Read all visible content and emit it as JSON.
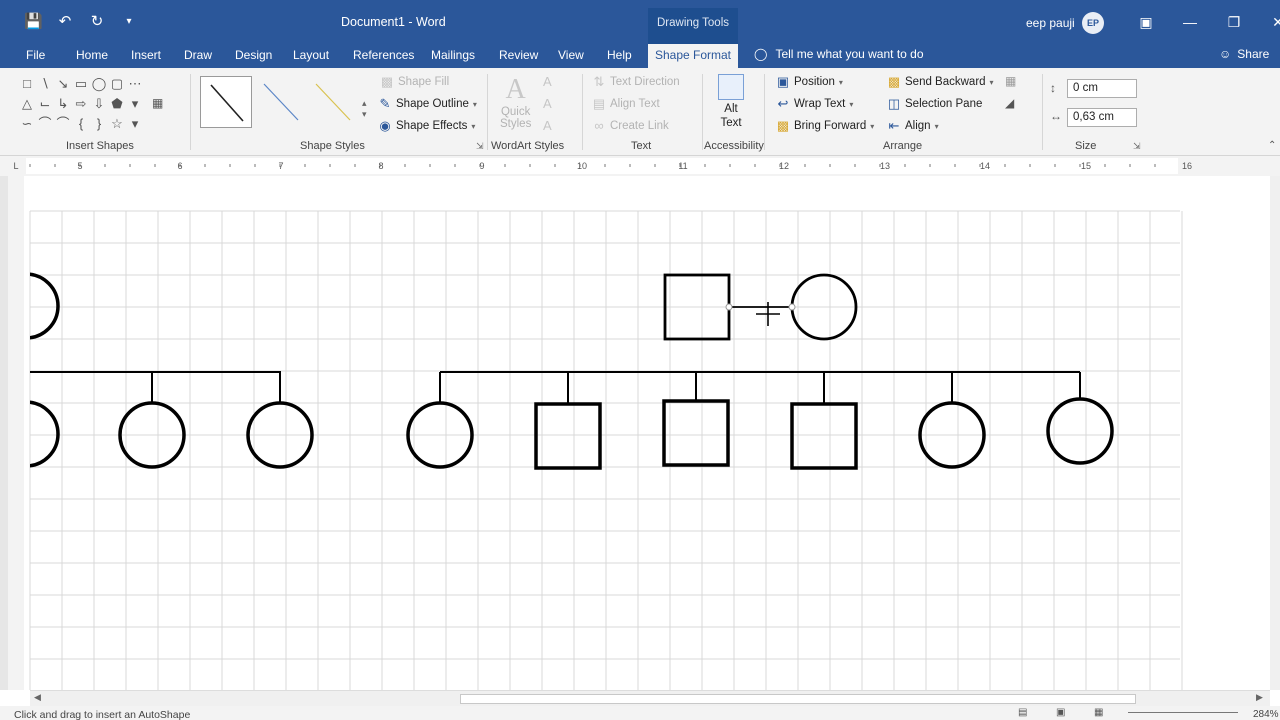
{
  "app": {
    "doc_title": "Document1 - Word",
    "contextual_label": "Drawing Tools",
    "user_name": "eep pauji",
    "user_initials": "EP",
    "accent_color": "#2b579a"
  },
  "qat": {
    "save_icon": "save-icon",
    "undo_icon": "undo-icon",
    "redo_icon": "redo-icon"
  },
  "tabs": [
    "File",
    "Home",
    "Insert",
    "Draw",
    "Design",
    "Layout",
    "References",
    "Mailings",
    "Review",
    "View",
    "Help"
  ],
  "active_tab": "Shape Format",
  "tell_me": "Tell me what you want to do",
  "share": "Share",
  "ribbon": {
    "groups": {
      "insert_shapes": "Insert Shapes",
      "shape_styles": "Shape Styles",
      "wordart_styles": "WordArt Styles",
      "text": "Text",
      "accessibility": "Accessibility",
      "arrange": "Arrange",
      "size": "Size"
    },
    "shape_fill": "Shape Fill",
    "shape_outline": "Shape Outline",
    "shape_effects": "Shape Effects",
    "quick_styles_1": "Quick",
    "quick_styles_2": "Styles",
    "text_direction": "Text Direction",
    "align_text": "Align Text",
    "create_link": "Create Link",
    "alt_text_1": "Alt",
    "alt_text_2": "Text",
    "position": "Position",
    "wrap_text": "Wrap Text",
    "bring_forward": "Bring Forward",
    "send_backward": "Send Backward",
    "selection_pane": "Selection Pane",
    "align": "Align",
    "height_value": "0 cm",
    "width_value": "0,63 cm"
  },
  "ruler_labels": [
    "5",
    "6",
    "7",
    "8",
    "9",
    "10",
    "11",
    "12",
    "13",
    "14",
    "15",
    "16"
  ],
  "status": {
    "text": "Click and drag to insert an AutoShape",
    "zoom": "284%"
  }
}
